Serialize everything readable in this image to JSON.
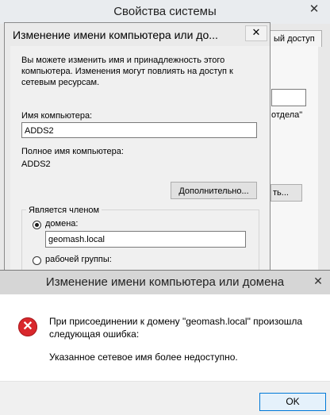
{
  "system_properties": {
    "title": "Свойства системы",
    "close_glyph": "✕",
    "tab_partial": "ый доступ",
    "text_partial": "отдела\"",
    "button_partial": "ть..."
  },
  "name_change_window": {
    "title": "Изменение имени компьютера или до...",
    "close_glyph": "✕",
    "intro": "Вы можете изменить имя и принадлежность этого компьютера. Изменения могут повлиять на доступ к сетевым ресурсам.",
    "computer_name_label": "Имя компьютера:",
    "computer_name_value": "ADDS2",
    "full_name_label": "Полное имя компьютера:",
    "full_name_value": "ADDS2",
    "more_button": "Дополнительно...",
    "member_of_legend": "Является членом",
    "domain_label": "домена:",
    "domain_value": "geomash.local",
    "workgroup_label": "рабочей группы:"
  },
  "error_dialog": {
    "title": "Изменение имени компьютера или домена",
    "close_glyph": "✕",
    "icon": "error-icon",
    "icon_glyph": "✕",
    "message_line1": "При присоединении к домену \"geomash.local\" произошла следующая ошибка:",
    "message_line2": "Указанное сетевое имя более недоступно.",
    "ok_button": "OK"
  }
}
